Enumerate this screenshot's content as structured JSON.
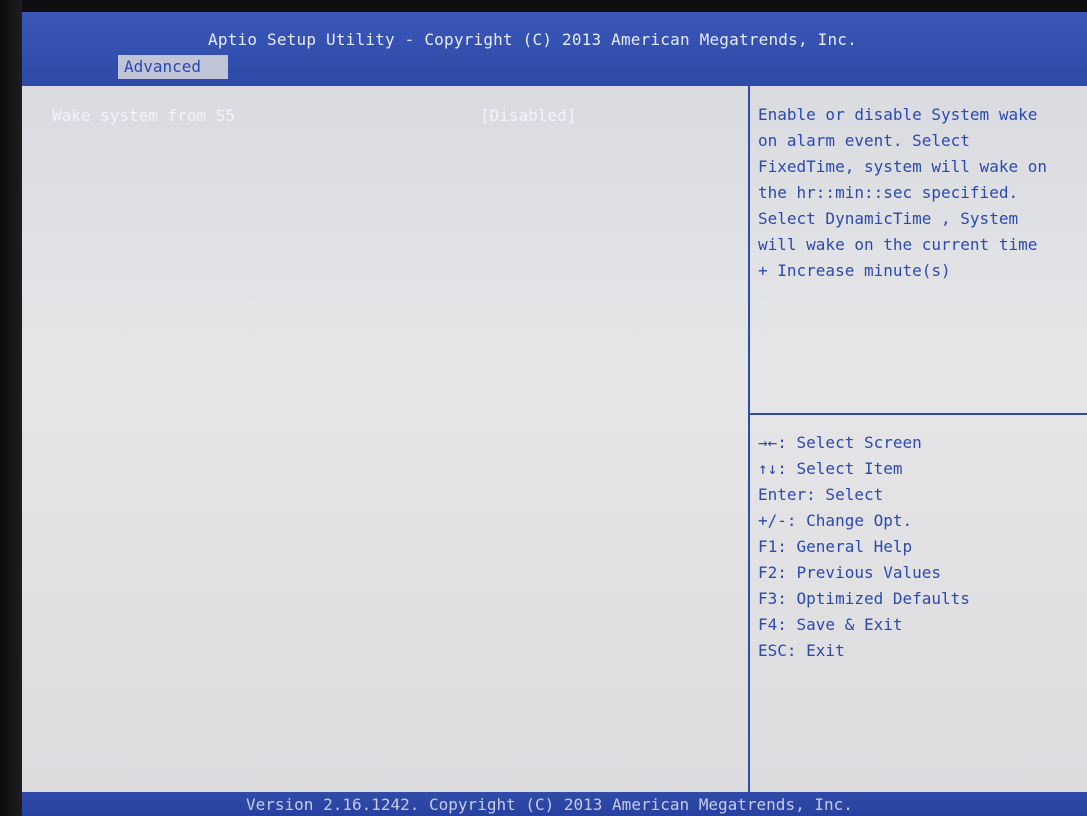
{
  "header": {
    "title": "Aptio Setup Utility - Copyright (C) 2013 American Megatrends, Inc.",
    "active_tab": "Advanced"
  },
  "settings": [
    {
      "label": "Wake system from S5",
      "value": "[Disabled]"
    }
  ],
  "help_text": "Enable or disable System wake\non alarm event. Select\nFixedTime, system will wake on\nthe hr::min::sec specified.\nSelect DynamicTime , System\nwill wake on the current time\n+ Increase minute(s)",
  "key_legend": [
    "→←: Select Screen",
    "↑↓: Select Item",
    "Enter: Select",
    "+/-: Change Opt.",
    "F1: General Help",
    "F2: Previous Values",
    "F3: Optimized Defaults",
    "F4: Save & Exit",
    "ESC: Exit"
  ],
  "footer": {
    "text": "Version 2.16.1242. Copyright (C) 2013 American Megatrends, Inc."
  },
  "colors": {
    "header_blue": "#2e4aa8",
    "panel_gray": "#e0e0e3",
    "help_text_blue": "#2b49b3",
    "setting_text": "#f2f4fb",
    "tab_bg": "#bfc5d6"
  }
}
